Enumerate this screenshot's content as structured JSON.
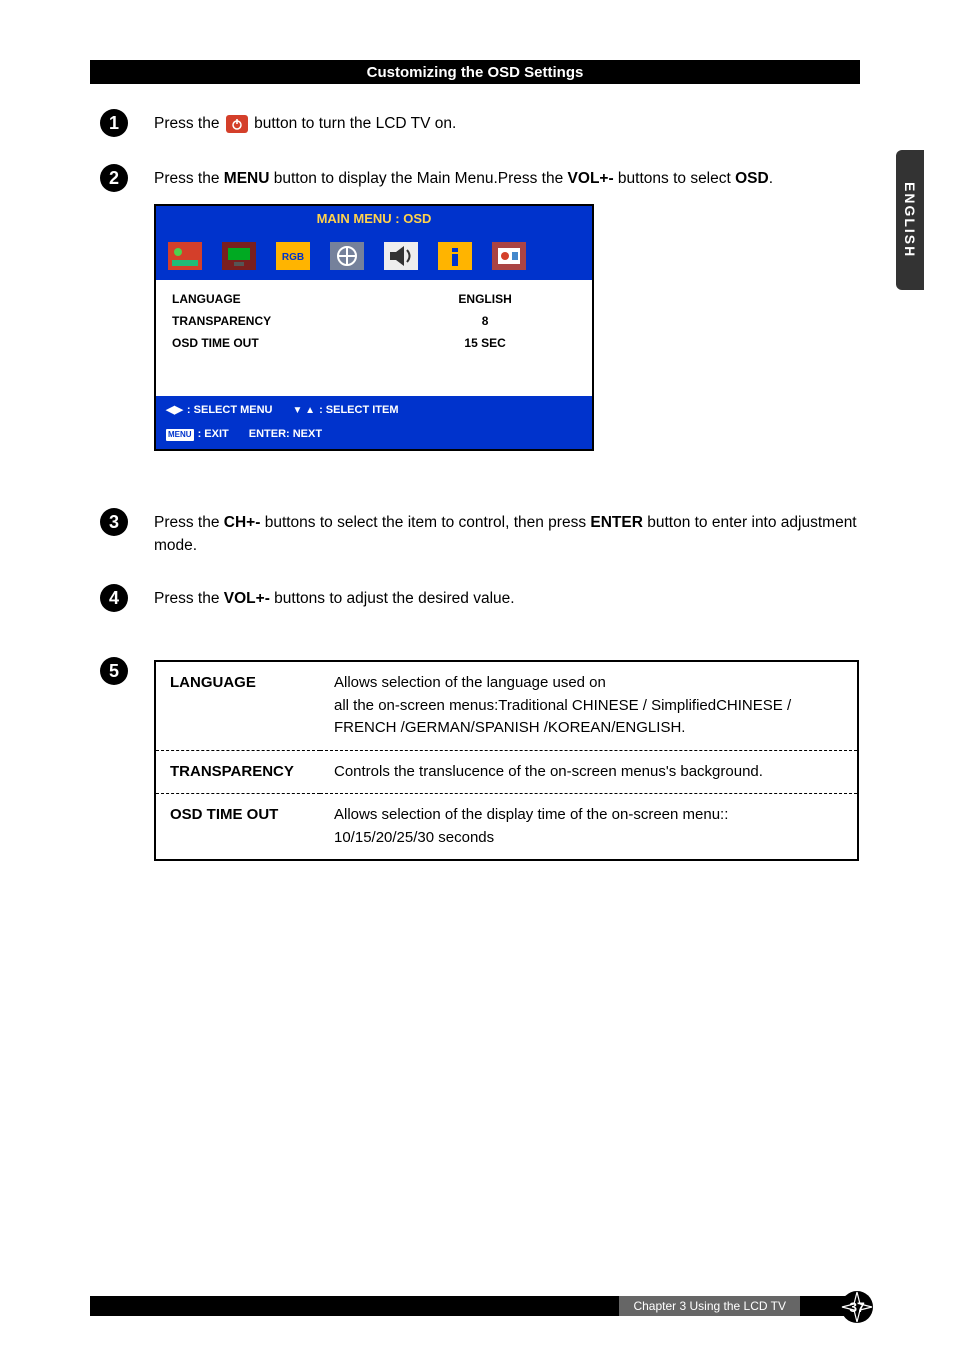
{
  "header": {
    "title": "Customizing the OSD Settings"
  },
  "sideTab": {
    "label": "ENGLISH"
  },
  "steps": {
    "s1": {
      "pre": "Press the ",
      "post": " button to turn the LCD TV on."
    },
    "s2": {
      "t1": "Press the ",
      "menu": "MENU",
      "t2": " button to display the Main Menu.Press the ",
      "vol": "VOL+-",
      "t3": " buttons to select ",
      "osd": "OSD",
      "t4": "."
    },
    "s3": {
      "t1": "Press the ",
      "ch": "CH+-",
      "t2": " buttons to select the item to control, then press ",
      "enter": "ENTER",
      "t3": " button to enter into adjustment mode."
    },
    "s4": {
      "t1": "Press the ",
      "vol": "VOL+-",
      "t2": " buttons to adjust the desired value."
    }
  },
  "osd": {
    "title": "MAIN MENU : OSD",
    "rows": [
      {
        "label": "LANGUAGE",
        "value": "ENGLISH"
      },
      {
        "label": "TRANSPARENCY",
        "value": "8"
      },
      {
        "label": "OSD TIME OUT",
        "value": "15 SEC"
      }
    ],
    "footer": {
      "selectMenu": ": SELECT MENU",
      "selectItem": ": SELECT ITEM",
      "exit": ": EXIT",
      "next": "ENTER: NEXT",
      "menuBadge": "MENU"
    }
  },
  "defs": {
    "rows": [
      {
        "term": "LANGUAGE",
        "desc": "Allows selection of the language used on\nall the on-screen menus:Traditional CHINESE / SimplifiedCHINESE / FRENCH /GERMAN/SPANISH /KOREAN/ENGLISH."
      },
      {
        "term": "TRANSPARENCY",
        "desc": "Controls the translucence of the on-screen menus's background."
      },
      {
        "term": "OSD TIME OUT",
        "desc": "Allows selection of the display time of the on-screen menu::\n10/15/20/25/30 seconds"
      }
    ]
  },
  "footer": {
    "chapter": "Chapter 3 Using the LCD TV",
    "page": "37"
  }
}
